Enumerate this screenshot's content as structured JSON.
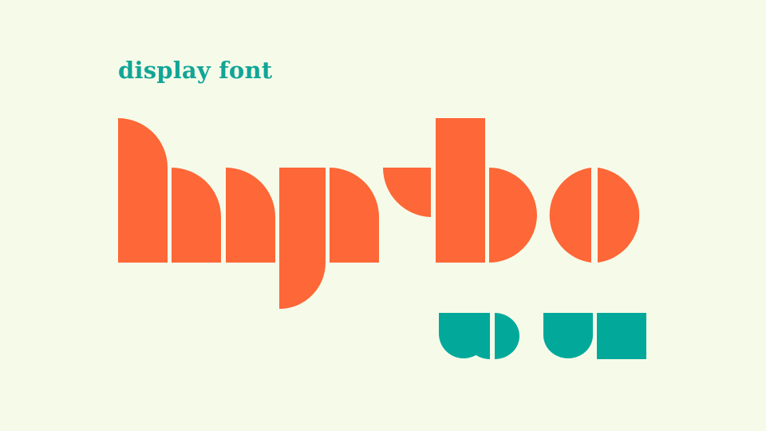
{
  "caption": {
    "text": "display font"
  },
  "logo": {
    "primary_word": "hyrbo",
    "secondary_word": "uoue",
    "style": "geometric stencil display lettering"
  },
  "colors": {
    "background": "#f6fbe9",
    "caption": "#12a597",
    "primary_letters": "#fe6737",
    "secondary_letters": "#02a99b"
  }
}
